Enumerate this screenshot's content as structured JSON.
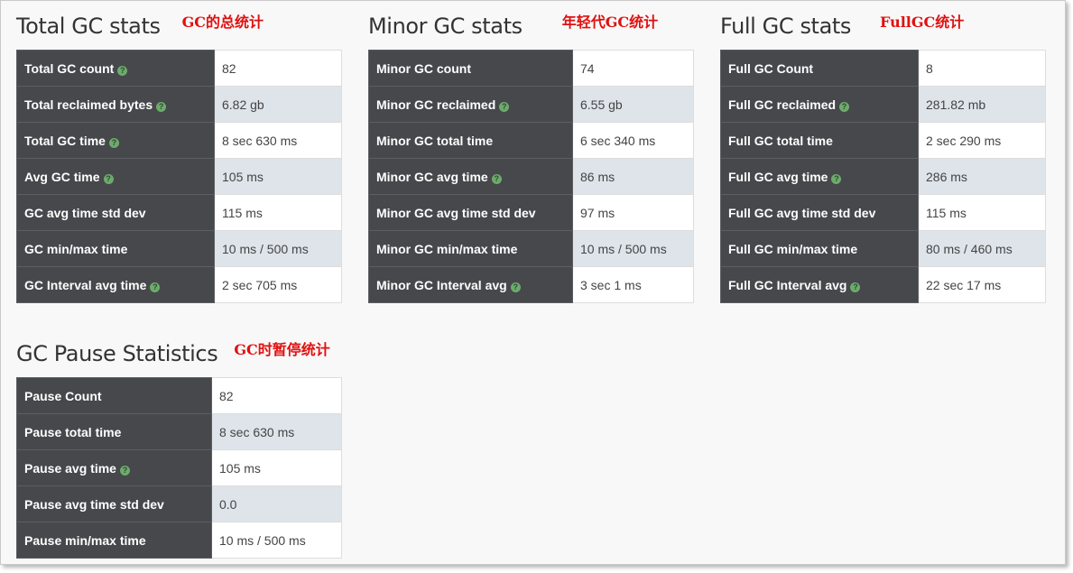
{
  "panels": {
    "total": {
      "title": "Total GC stats",
      "note": "GC的总统计",
      "rows": [
        {
          "label": "Total GC count",
          "value": "82"
        },
        {
          "label": "Total reclaimed bytes",
          "value": "6.82 gb"
        },
        {
          "label": "Total GC time",
          "value": "8 sec 630 ms"
        },
        {
          "label": "Avg GC time",
          "value": "105 ms"
        },
        {
          "label": "GC avg time std dev",
          "value": "115 ms"
        },
        {
          "label": "GC min/max time",
          "value": "10 ms / 500 ms"
        },
        {
          "label": "GC Interval avg time",
          "value": "2 sec 705 ms"
        }
      ]
    },
    "minor": {
      "title": "Minor GC stats",
      "note": "年轻代GC统计",
      "rows": [
        {
          "label": "Minor GC count",
          "value": "74"
        },
        {
          "label": "Minor GC reclaimed",
          "value": "6.55 gb"
        },
        {
          "label": "Minor GC total time",
          "value": "6 sec 340 ms"
        },
        {
          "label": "Minor GC avg time",
          "value": "86 ms"
        },
        {
          "label": "Minor GC avg time std dev",
          "value": "97 ms"
        },
        {
          "label": "Minor GC min/max time",
          "value": "10 ms / 500 ms"
        },
        {
          "label": "Minor GC Interval avg",
          "value": "3 sec 1 ms"
        }
      ]
    },
    "full": {
      "title": "Full GC stats",
      "note": "FullGC统计",
      "rows": [
        {
          "label": "Full GC Count",
          "value": "8"
        },
        {
          "label": "Full GC reclaimed",
          "value": "281.82 mb"
        },
        {
          "label": "Full GC total time",
          "value": "2 sec 290 ms"
        },
        {
          "label": "Full GC avg time",
          "value": "286 ms"
        },
        {
          "label": "Full GC avg time std dev",
          "value": "115 ms"
        },
        {
          "label": "Full GC min/max time",
          "value": "80 ms / 460 ms"
        },
        {
          "label": "Full GC Interval avg",
          "value": "22 sec 17 ms"
        }
      ]
    },
    "pause": {
      "title": "GC Pause Statistics",
      "note": "GC时暂停统计",
      "rows": [
        {
          "label": "Pause Count",
          "value": "82"
        },
        {
          "label": "Pause total time",
          "value": "8 sec 630 ms"
        },
        {
          "label": "Pause avg time",
          "value": "105 ms"
        },
        {
          "label": "Pause avg time std dev",
          "value": "0.0"
        },
        {
          "label": "Pause min/max time",
          "value": "10 ms / 500 ms"
        }
      ]
    }
  },
  "help_glyph": "?",
  "icons": {
    "help": "question-circle-icon"
  },
  "colors": {
    "label_bg": "#46484b",
    "stripe_bg": "#dee4ea",
    "note": "#e01010",
    "help": "#6dab6d"
  }
}
